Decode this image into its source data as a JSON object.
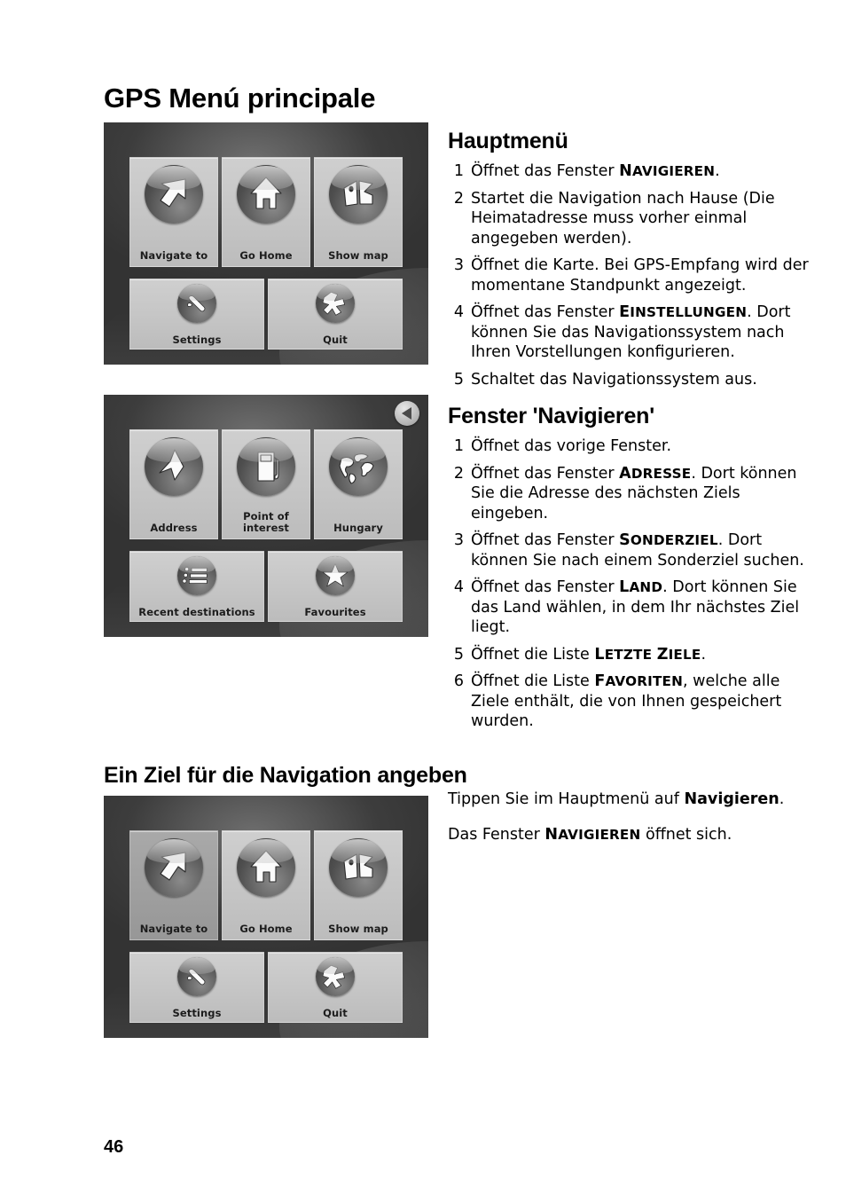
{
  "document": {
    "title": "GPS Menú principale",
    "page_number": "46"
  },
  "sections": {
    "hauptmenu": {
      "heading": "Hauptmenü",
      "steps": [
        {
          "num": "1",
          "parts": [
            {
              "t": "Öffnet das Fenster "
            },
            {
              "t": "NAVIGIEREN",
              "style": "smallcaps"
            },
            {
              "t": "."
            }
          ]
        },
        {
          "num": "2",
          "parts": [
            {
              "t": "Startet die Navigation nach Hause (Die Heimatadresse muss vorher einmal angegeben werden)."
            }
          ]
        },
        {
          "num": "3",
          "parts": [
            {
              "t": "Öffnet die Karte. Bei GPS-Empfang wird der momentane Standpunkt angezeigt."
            }
          ]
        },
        {
          "num": "4",
          "parts": [
            {
              "t": "Öffnet das Fenster "
            },
            {
              "t": "EINSTELLUNGEN",
              "style": "smallcaps"
            },
            {
              "t": ". Dort können Sie das Navigationssystem nach Ihren Vorstellungen konfigurieren."
            }
          ]
        },
        {
          "num": "5",
          "parts": [
            {
              "t": "Schaltet das Navigationssystem aus."
            }
          ]
        }
      ]
    },
    "navigieren": {
      "heading": "Fenster 'Navigieren'",
      "steps": [
        {
          "num": "1",
          "parts": [
            {
              "t": "Öffnet das vorige Fenster."
            }
          ]
        },
        {
          "num": "2",
          "parts": [
            {
              "t": "Öffnet das Fenster "
            },
            {
              "t": "ADRESSE",
              "style": "smallcaps"
            },
            {
              "t": ". Dort können Sie die Adresse des nächsten Ziels eingeben."
            }
          ]
        },
        {
          "num": "3",
          "parts": [
            {
              "t": "Öffnet das Fenster "
            },
            {
              "t": "SONDERZIEL",
              "style": "smallcaps"
            },
            {
              "t": ". Dort können Sie nach einem Sonderziel suchen."
            }
          ]
        },
        {
          "num": "4",
          "parts": [
            {
              "t": "Öffnet das Fenster "
            },
            {
              "t": "LAND",
              "style": "smallcaps"
            },
            {
              "t": ". Dort können Sie das Land wählen, in dem Ihr nächstes Ziel liegt."
            }
          ]
        },
        {
          "num": "5",
          "parts": [
            {
              "t": "Öffnet die Liste "
            },
            {
              "t": "LETZTE ZIELE",
              "style": "smallcaps"
            },
            {
              "t": "."
            }
          ]
        },
        {
          "num": "6",
          "parts": [
            {
              "t": "Öffnet die Liste "
            },
            {
              "t": "FAVORITEN",
              "style": "smallcaps"
            },
            {
              "t": ", welche alle Ziele enthält, die von Ihnen gespeichert wurden."
            }
          ]
        }
      ]
    },
    "ziel": {
      "heading": "Ein Ziel für die Navigation angeben",
      "paragraphs": [
        [
          {
            "t": "Tippen Sie im Hauptmenü auf "
          },
          {
            "t": "Navigieren",
            "style": "bold"
          },
          {
            "t": "."
          }
        ],
        [
          {
            "t": "Das Fenster "
          },
          {
            "t": "NAVIGIEREN",
            "style": "smallcaps"
          },
          {
            "t": " öffnet sich."
          }
        ]
      ]
    }
  },
  "screenshots": {
    "main_menu": {
      "caption_alt": "Hauptmenü Screenshot",
      "tiles": [
        {
          "label": "Navigate to",
          "icon": "arrow-up-right-icon",
          "pressed": false
        },
        {
          "label": "Go Home",
          "icon": "house-icon",
          "pressed": false
        },
        {
          "label": "Show map",
          "icon": "map-icon",
          "pressed": false
        },
        {
          "label": "Settings",
          "icon": "wrench-icon",
          "pressed": false
        },
        {
          "label": "Quit",
          "icon": "cross-icon",
          "pressed": false
        }
      ]
    },
    "navigate_menu": {
      "caption_alt": "Fenster Navigieren Screenshot",
      "back_button": "back-arrow-icon",
      "tiles": [
        {
          "label": "Address",
          "icon": "flag-icon",
          "pressed": false
        },
        {
          "label": "Point of interest",
          "icon": "fuel-pump-icon",
          "pressed": false
        },
        {
          "label": "Hungary",
          "icon": "globe-icon",
          "pressed": false
        },
        {
          "label": "Recent destinations",
          "icon": "list-icon",
          "pressed": false
        },
        {
          "label": "Favourites",
          "icon": "star-icon",
          "pressed": false
        }
      ]
    },
    "main_menu_pressed": {
      "caption_alt": "Hauptmenü Screenshot mit markiertem Navigieren",
      "tiles": [
        {
          "label": "Navigate to",
          "icon": "arrow-up-right-icon",
          "pressed": true
        },
        {
          "label": "Go Home",
          "icon": "house-icon",
          "pressed": false
        },
        {
          "label": "Show map",
          "icon": "map-icon",
          "pressed": false
        },
        {
          "label": "Settings",
          "icon": "wrench-icon",
          "pressed": false
        },
        {
          "label": "Quit",
          "icon": "cross-icon",
          "pressed": false
        }
      ]
    }
  },
  "colors": {
    "page_background": "#ffffff",
    "text": "#000000",
    "device_background": "#3d3d3d",
    "tile_face": "#c5c5c5",
    "tile_pressed": "#9f9f9f",
    "orb_dark": "#4e4e4e",
    "glyph": "#fbfbfb"
  }
}
